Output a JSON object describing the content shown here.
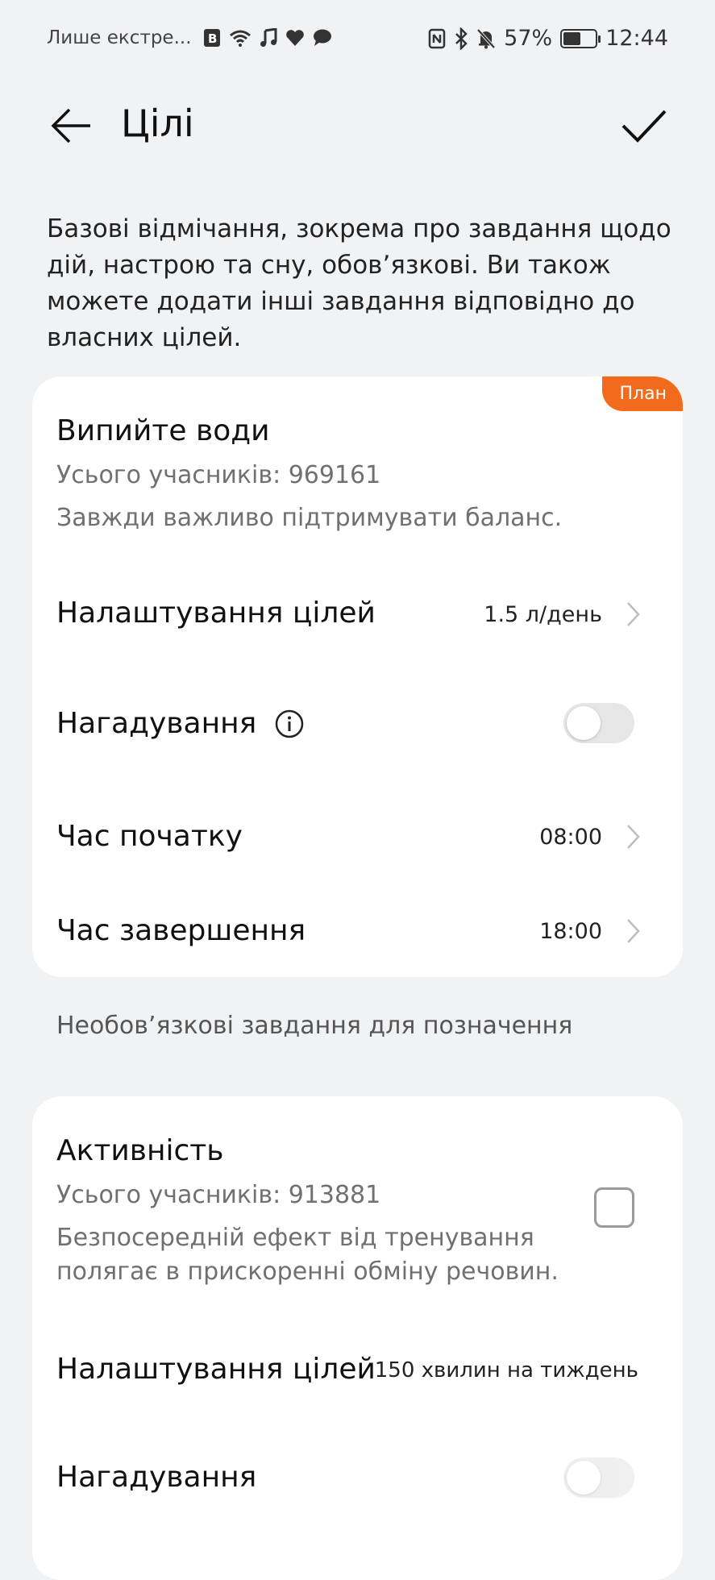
{
  "status_bar": {
    "carrier": "Лише екстре...",
    "battery_percent": "57%",
    "battery_level": 0.57,
    "time": "12:44"
  },
  "header": {
    "title": "Цілі"
  },
  "intro_text": "Базові відмічання, зокрема про завдання щодо дій, настрою та сну, обов’язкові. Ви також можете додати інші завдання відповідно до власних цілей.",
  "water_task": {
    "badge": "План",
    "title": "Випийте води",
    "participants": "Усього учасників: 969161",
    "description": "Завжди важливо підтримувати баланс.",
    "goal_label": "Налаштування цілей",
    "goal_value": "1.5 л/день",
    "reminder_label": "Нагадування",
    "reminder_on": false,
    "start_label": "Час початку",
    "start_value": "08:00",
    "end_label": "Час завершення",
    "end_value": "18:00"
  },
  "optional_section_label": "Необов’язкові завдання для позначення",
  "activity_task": {
    "title": "Активність",
    "participants": "Усього учасників: 913881",
    "description_line1": "Безпосередній ефект від тренування",
    "description_line2": "полягає в прискоренні обміну речовин.",
    "checked": false,
    "goal_label": "Налаштування цілей",
    "goal_value": "150 хвилин на тиждень",
    "reminder_label": "Нагадування",
    "reminder_on": false
  },
  "icons": {
    "back": "arrow-left-icon",
    "confirm": "checkmark-icon",
    "info": "info-circle-icon",
    "chevron": "chevron-right-icon"
  },
  "colors": {
    "background": "#f1f2f4",
    "badge": "#f26a1b",
    "card": "#ffffff"
  }
}
